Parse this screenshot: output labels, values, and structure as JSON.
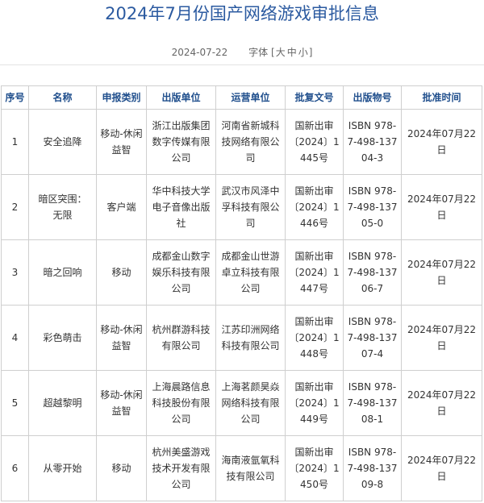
{
  "page": {
    "title": "2024年7月份国产网络游戏审批信息",
    "date": "2024-07-22",
    "font_label": "字体",
    "bracket_open": "[",
    "bracket_close": "]",
    "font_sizes": [
      "大",
      "中",
      "小"
    ]
  },
  "table": {
    "headers": [
      "序号",
      "名称",
      "申报类别",
      "出版单位",
      "运营单位",
      "批复文号",
      "出版物号",
      "批准时间"
    ],
    "rows": [
      [
        "1",
        "安全追降",
        "移动-休闲益智",
        "浙江出版集团数字传媒有限公司",
        "河南省新城科技网络有限公司",
        "国新出审〔2024〕1445号",
        "ISBN 978-7-498-13704-3",
        "2024年07月22日"
      ],
      [
        "2",
        "暗区突围：无限",
        "客户端",
        "华中科技大学电子音像出版社",
        "武汉市风泽中孚科技有限公司",
        "国新出审〔2024〕1446号",
        "ISBN 978-7-498-13705-0",
        "2024年07月22日"
      ],
      [
        "3",
        "暗之回响",
        "移动",
        "成都金山数字娱乐科技有限公司",
        "成都金山世游卓立科技有限公司",
        "国新出审〔2024〕1447号",
        "ISBN 978-7-498-13706-7",
        "2024年07月22日"
      ],
      [
        "4",
        "彩色萌击",
        "移动-休闲益智",
        "杭州群游科技有限公司",
        "江苏印洲网络科技有限公司",
        "国新出审〔2024〕1448号",
        "ISBN 978-7-498-13707-4",
        "2024年07月22日"
      ],
      [
        "5",
        "超越黎明",
        "移动-休闲益智",
        "上海晨路信息科技股份有限公司",
        "上海茗颜昊焱网络科技有限公司",
        "国新出审〔2024〕1449号",
        "ISBN 978-7-498-13708-1",
        "2024年07月22日"
      ],
      [
        "6",
        "从零开始",
        "移动",
        "杭州美盛游戏技术开发有限公司",
        "海南液氩氧科技有限公司",
        "国新出审〔2024〕1450号",
        "ISBN 978-7-498-13709-8",
        "2024年07月22日"
      ]
    ]
  }
}
